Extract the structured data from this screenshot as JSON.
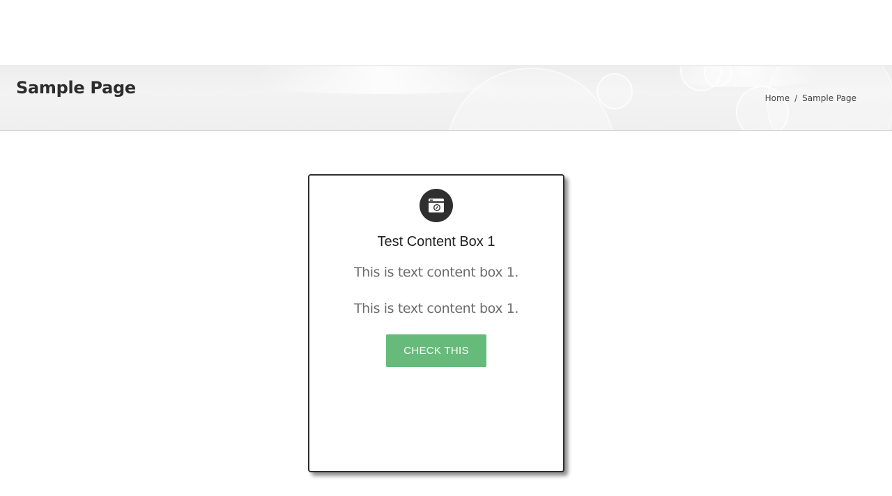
{
  "header": {
    "page_title": "Sample Page",
    "breadcrumb": {
      "home_label": "Home",
      "separator": "/",
      "current_label": "Sample Page"
    }
  },
  "content_box": {
    "icon": "camera-icon",
    "title": "Test Content Box 1",
    "paragraphs": [
      "This is text content box 1.",
      "This is text content box 1."
    ],
    "button_label": "CHECK THIS"
  },
  "colors": {
    "button_background": "#66bb7a",
    "icon_circle": "#2f2f2f",
    "card_border": "#2d2d2d"
  }
}
